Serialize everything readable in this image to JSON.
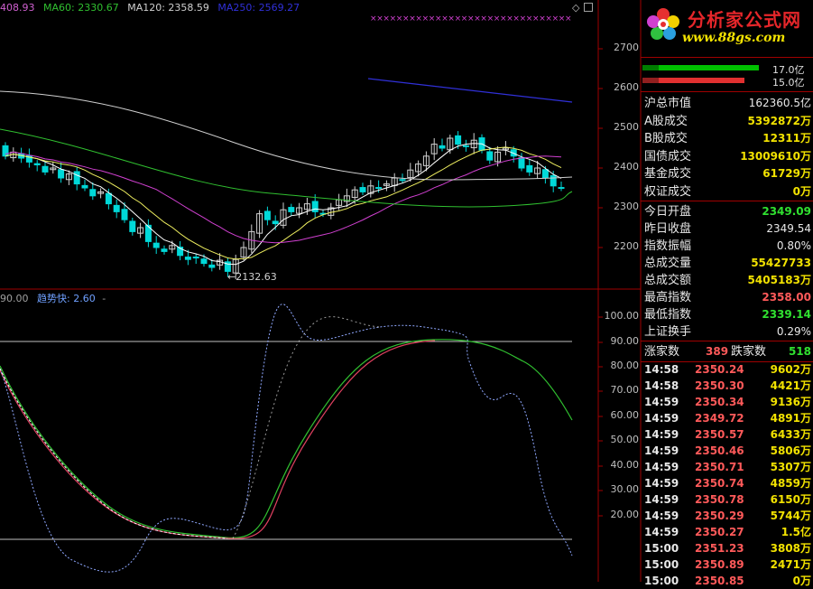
{
  "chart_legend": {
    "ma_items": [
      {
        "label": "408.93",
        "color": "#d060d0"
      },
      {
        "label": "MA60: 2330.67",
        "color": "#30c030"
      },
      {
        "label": "MA120: 2358.59",
        "color": "#d0d0d0"
      },
      {
        "label": "MA250: 2569.27",
        "color": "#3030d8"
      }
    ],
    "corner_marker": "◇",
    "low_annotation": "←2132.63"
  },
  "indicator_legend": {
    "prefix": "90.00",
    "name": "趋势快: 2.60",
    "suffix": "-"
  },
  "price_axis": [
    "2700",
    "2600",
    "2500",
    "2400",
    "2300",
    "2200"
  ],
  "indicator_axis": [
    "100.00",
    "90.00",
    "80.00",
    "70.00",
    "60.00",
    "50.00",
    "40.00",
    "30.00",
    "20.00"
  ],
  "logo": {
    "title": "分析家公式网",
    "url": "www.88gs.com"
  },
  "ratio_bars": [
    {
      "label": "17.0亿",
      "color": "#00c000",
      "fraction": 0.92
    },
    {
      "label": "15.0亿",
      "color": "#e03030",
      "fraction": 0.81
    }
  ],
  "market_info": [
    {
      "key": "沪总市值",
      "value": "162360.5亿",
      "color": "#e8e8e8"
    },
    {
      "key": "A股成交",
      "value": "5392872万",
      "color": "#f2e200"
    },
    {
      "key": "B股成交",
      "value": "12311万",
      "color": "#f2e200"
    },
    {
      "key": "国债成交",
      "value": "13009610万",
      "color": "#f2e200"
    },
    {
      "key": "基金成交",
      "value": "61729万",
      "color": "#f2e200"
    },
    {
      "key": "权证成交",
      "value": "0万",
      "color": "#f2e200"
    }
  ],
  "index_info": [
    {
      "key": "今日开盘",
      "value": "2349.09",
      "color": "#30e030"
    },
    {
      "key": "昨日收盘",
      "value": "2349.54",
      "color": "#e8e8e8"
    },
    {
      "key": "指数振幅",
      "value": "0.80%",
      "color": "#e8e8e8"
    },
    {
      "key": "总成交量",
      "value": "55427733",
      "color": "#f2e200"
    },
    {
      "key": "总成交额",
      "value": "5405183万",
      "color": "#f2e200"
    },
    {
      "key": "最高指数",
      "value": "2358.00",
      "color": "#ff5a5a"
    },
    {
      "key": "最低指数",
      "value": "2339.14",
      "color": "#30e030"
    },
    {
      "key": "上证换手",
      "value": "0.29%",
      "color": "#e8e8e8"
    }
  ],
  "advance_decline": {
    "up_label": "涨家数",
    "up_value": "389",
    "down_label": "跌家数",
    "down_value": "518"
  },
  "ticks": [
    {
      "time": "14:58",
      "price": "2350.24",
      "vol": "9602万"
    },
    {
      "time": "14:58",
      "price": "2350.30",
      "vol": "4421万"
    },
    {
      "time": "14:59",
      "price": "2350.34",
      "vol": "9136万"
    },
    {
      "time": "14:59",
      "price": "2349.72",
      "vol": "4891万"
    },
    {
      "time": "14:59",
      "price": "2350.57",
      "vol": "6433万"
    },
    {
      "time": "14:59",
      "price": "2350.46",
      "vol": "5806万"
    },
    {
      "time": "14:59",
      "price": "2350.71",
      "vol": "5307万"
    },
    {
      "time": "14:59",
      "price": "2350.74",
      "vol": "4859万"
    },
    {
      "time": "14:59",
      "price": "2350.78",
      "vol": "6150万"
    },
    {
      "time": "14:59",
      "price": "2350.29",
      "vol": "5744万"
    },
    {
      "time": "14:59",
      "price": "2350.27",
      "vol": "1.5亿"
    },
    {
      "time": "15:00",
      "price": "2351.23",
      "vol": "3808万"
    },
    {
      "time": "15:00",
      "price": "2350.89",
      "vol": "2471万"
    },
    {
      "time": "15:00",
      "price": "2350.85",
      "vol": "0万"
    }
  ],
  "colors": {
    "background": "#000000",
    "grid": "#a00000",
    "up_candle": "#d0d0d0",
    "down_candle": "#00d8d8",
    "ma5": "#ffffff",
    "ma10": "#f0f060",
    "ma20": "#d040d0",
    "ma60": "#30c030",
    "ma120": "#d0d0d0",
    "ma250": "#3030d8"
  }
}
